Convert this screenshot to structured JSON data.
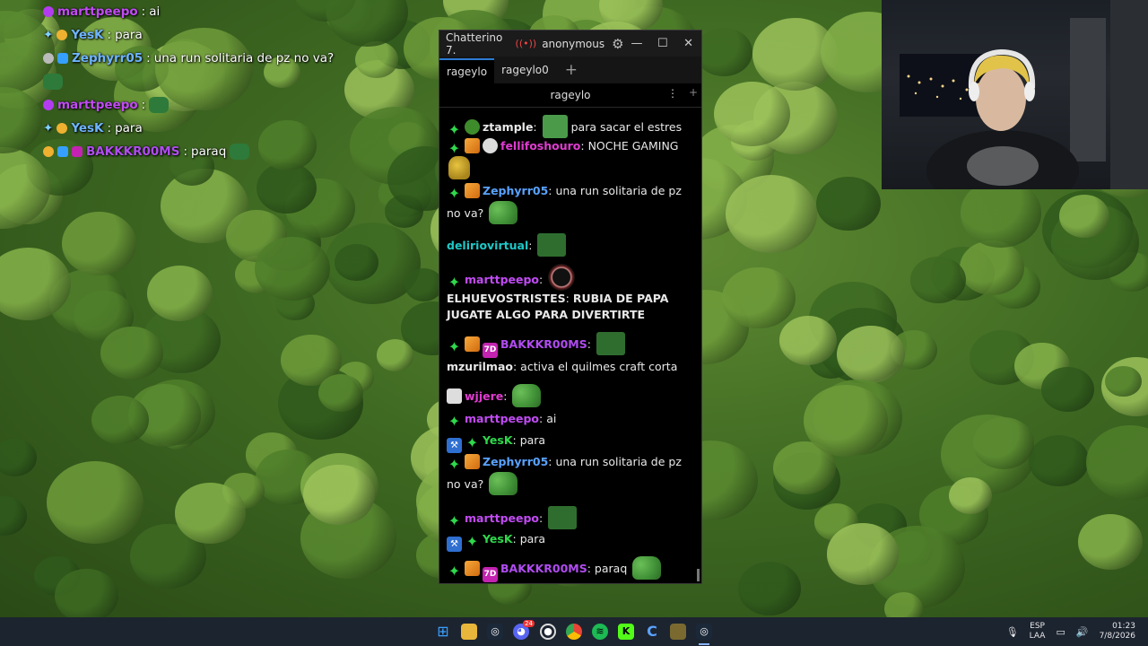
{
  "overlay": {
    "lines": [
      {
        "user": "marttpeepo",
        "text": "ai",
        "user_color": "#c24bf5"
      },
      {
        "user": "YesK",
        "text": "para",
        "user_color": "#6eb4ff"
      },
      {
        "user": "Zephyrr05",
        "text": "una run solitaria de pz no va?",
        "user_color": "#6eb4ff"
      },
      {
        "user": "marttpeepo",
        "text": "",
        "user_color": "#c24bf5"
      },
      {
        "user": "YesK",
        "text": "para",
        "user_color": "#6eb4ff"
      },
      {
        "user": "BAKKKR00MS",
        "text": "paraq",
        "user_color": "#b04cf0"
      }
    ]
  },
  "window": {
    "app_title": "Chatterino 7.",
    "account": "anonymous",
    "tabs": [
      "rageylo",
      "rageylo0"
    ],
    "active_tab": "rageylo",
    "add_tab": "+",
    "channel": "rageylo"
  },
  "messages": [
    {
      "user": "ztample",
      "text": "para sacar el estres",
      "user_color": "#e8e8e8"
    },
    {
      "user": "fellifoshouro",
      "text": "NOCHE GAMING",
      "user_color": "#e03cd0"
    },
    {
      "user": "Zephyrr05",
      "text": "una run solitaria de pz no va?",
      "user_color": "#5aa2ff"
    },
    {
      "user": "deliriovirtual",
      "text": "",
      "user_color": "#1ec8c8"
    },
    {
      "user": "marttpeepo",
      "text": "",
      "user_color": "#c24bf5"
    },
    {
      "user": "ELHUEVOSTRISTES",
      "text": "RUBIA DE PAPA JUGATE ALGO PARA DIVERTIRTE",
      "user_color": "#e8e8e8"
    },
    {
      "user": "BAKKKR00MS",
      "text": "",
      "user_color": "#b04cf0"
    },
    {
      "user": "mzurilmao",
      "text": "activa el quilmes craft corta",
      "user_color": "#e8e8e8"
    },
    {
      "user": "wjjere",
      "text": "",
      "user_color": "#e03cd0"
    },
    {
      "user": "marttpeepo",
      "text": "ai",
      "user_color": "#c24bf5"
    },
    {
      "user": "YesK",
      "text": "para",
      "user_color": "#2fd84c"
    },
    {
      "user": "Zephyrr05",
      "text": "una run solitaria de pz no va?",
      "user_color": "#5aa2ff"
    },
    {
      "user": "marttpeepo",
      "text": "",
      "user_color": "#c24bf5"
    },
    {
      "user": "YesK",
      "text": "para",
      "user_color": "#2fd84c"
    },
    {
      "user": "BAKKKR00MS",
      "text": "paraq",
      "user_color": "#b04cf0"
    }
  ],
  "taskbar": {
    "discord_badge": "24",
    "tray_lang_1": "ESP",
    "tray_lang_2": "LAA",
    "time": "01:23",
    "date": "7/8/2026"
  }
}
